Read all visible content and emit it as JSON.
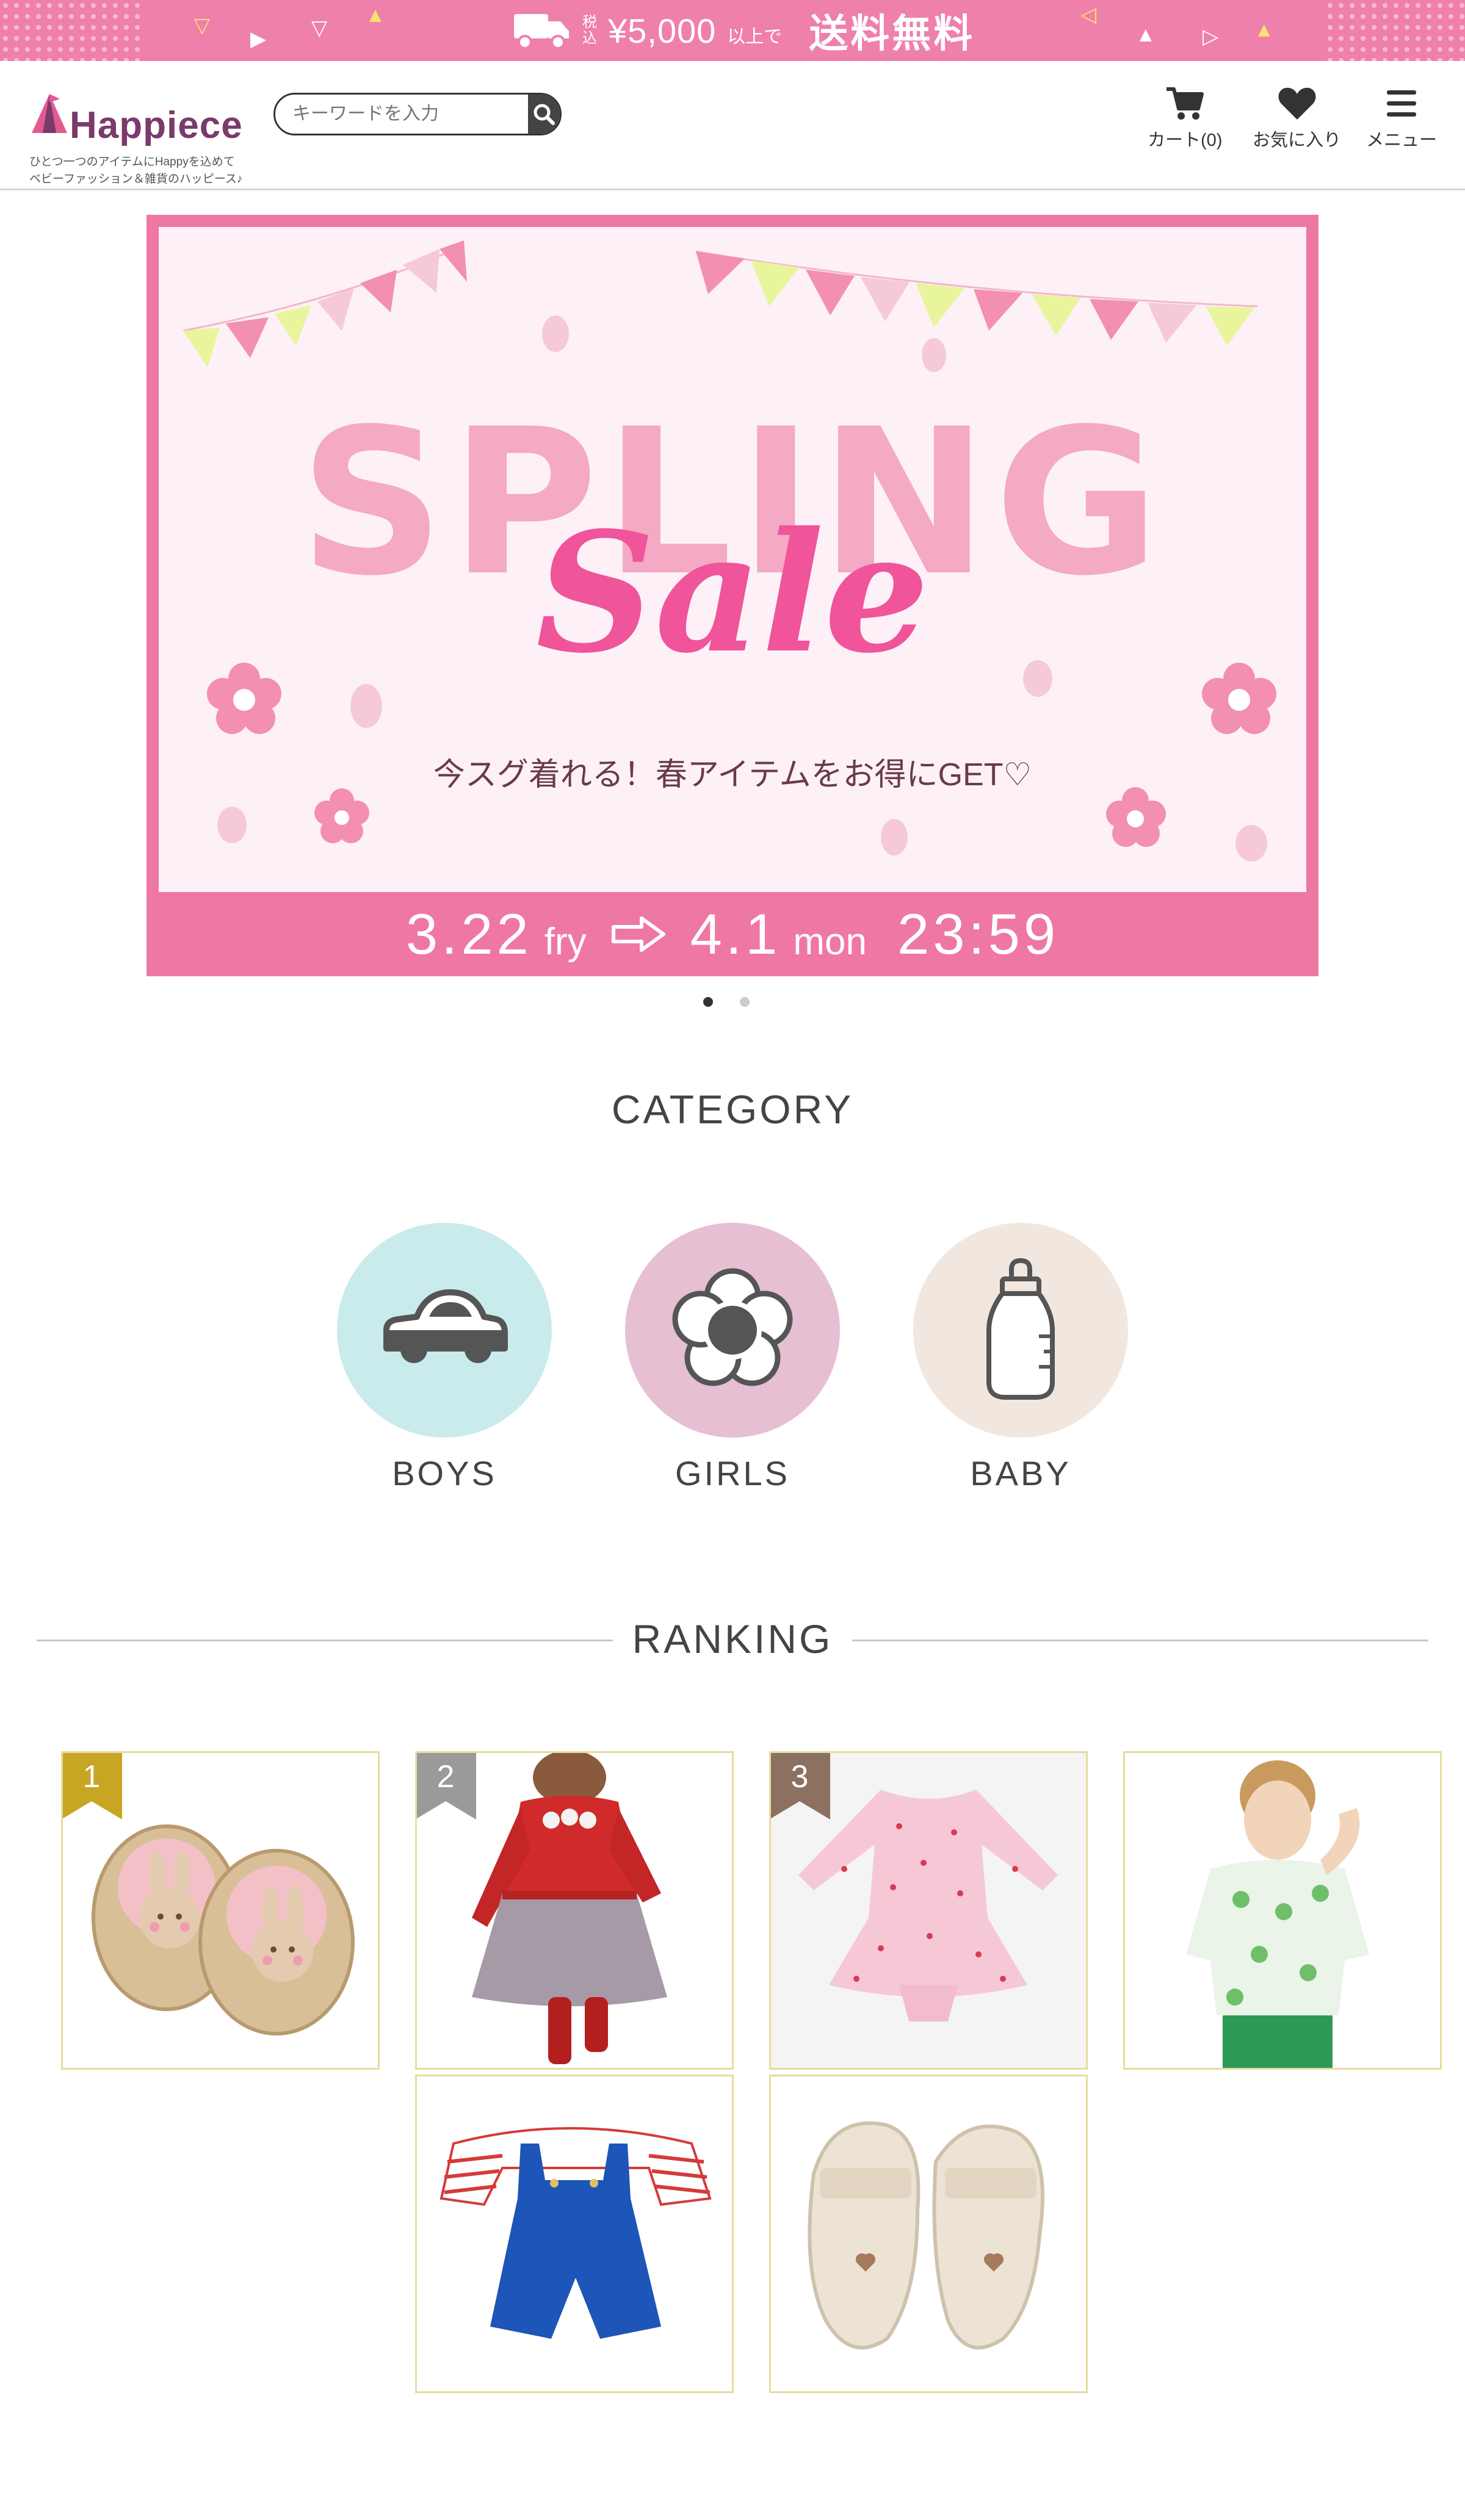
{
  "top_banner": {
    "tax_line1": "税",
    "tax_line2": "込",
    "price": "¥5,000",
    "above": "以上で",
    "free_shipping": "送料無料"
  },
  "header": {
    "logo_text": "Happiece",
    "tagline1": "ひとつ一つのアイテムにHappyを込めて",
    "tagline2": "ベビーファッション＆雑貨のハッピース♪",
    "search_placeholder": "キーワードを入力",
    "cart_label": "カート(0)",
    "favorites_label": "お気に入り",
    "menu_label": "メニュー"
  },
  "hero": {
    "title_word": "SPLING",
    "sale_word": "Sale",
    "subtitle": "今スグ着れる！春アイテムをお得にGET♡",
    "start_date": "3.22",
    "start_day": "fry",
    "end_date": "4.1",
    "end_day": "mon",
    "end_time": "23:59",
    "slide_count": 2,
    "active_slide": 1
  },
  "category": {
    "title": "CATEGORY",
    "items": [
      {
        "label": "BOYS",
        "icon": "car-icon",
        "color": "#c9ebeb"
      },
      {
        "label": "GIRLS",
        "icon": "flower-icon",
        "color": "#e6bfd3"
      },
      {
        "label": "BABY",
        "icon": "baby-bottle-icon",
        "color": "#f1e7df"
      }
    ]
  },
  "ranking": {
    "title": "RANKING",
    "items": [
      {
        "rank": "1",
        "badge_color": "#c9a524",
        "product": "bunny baby shoes"
      },
      {
        "rank": "2",
        "badge_color": "#9a9a9a",
        "product": "red top with grey skirt"
      },
      {
        "rank": "3",
        "badge_color": "#8c7060",
        "product": "pink polka dot romper"
      },
      {
        "rank": "",
        "product": "boy in dinosaur shirt"
      },
      {
        "rank": "",
        "product": "blue overalls with striped top"
      },
      {
        "rank": "",
        "product": "beige baby sneakers"
      }
    ]
  }
}
